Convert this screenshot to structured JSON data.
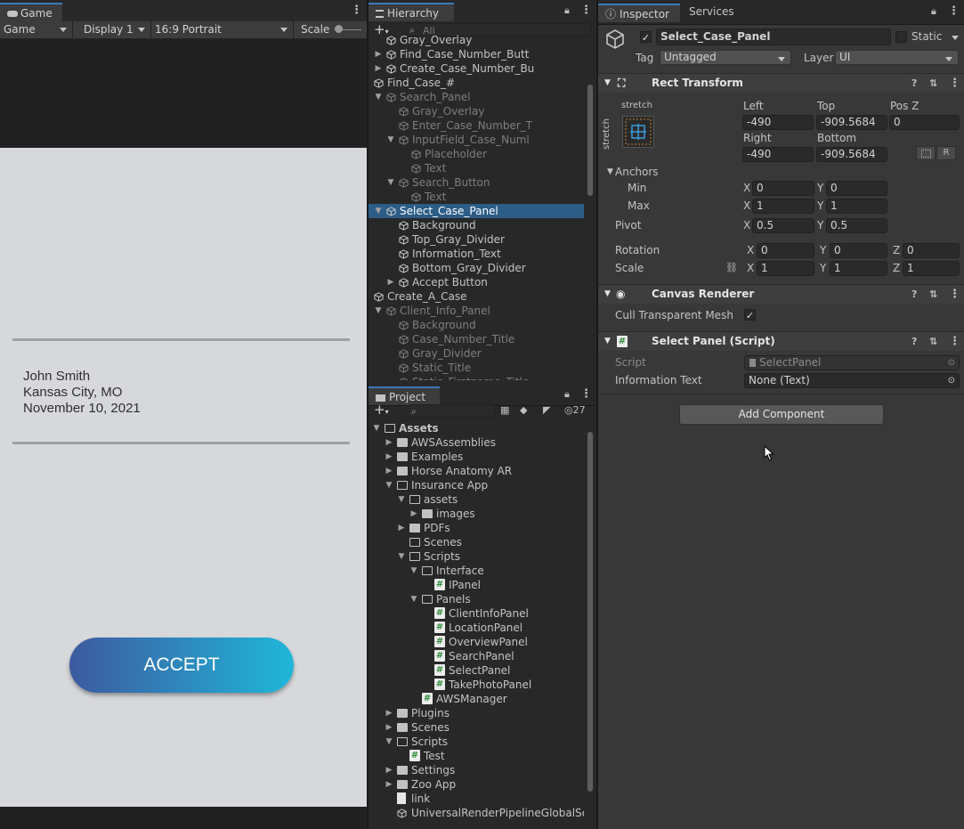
{
  "game": {
    "tab_label": "Game",
    "mode": "Game",
    "display": "Display 1",
    "aspect": "16:9 Portrait",
    "scale_label": "Scale",
    "info_lines": [
      "John Smith",
      "Kansas City, MO",
      "November 10, 2021"
    ],
    "accept_label": "ACCEPT"
  },
  "hierarchy": {
    "tab_label": "Hierarchy",
    "search_placeholder": "All",
    "rows": [
      {
        "label": "Gray_Overlay",
        "depth": 4,
        "arrow": "",
        "dim": false,
        "sel": false
      },
      {
        "label": "Find_Case_Number_Butt",
        "depth": 4,
        "arrow": "right",
        "dim": false,
        "sel": false
      },
      {
        "label": "Create_Case_Number_Bu",
        "depth": 4,
        "arrow": "right",
        "dim": false,
        "sel": false
      },
      {
        "label": "Find_Case_#",
        "depth": 3,
        "arrow": "down",
        "dim": false,
        "sel": false
      },
      {
        "label": "Search_Panel",
        "depth": 4,
        "arrow": "down",
        "dim": true,
        "sel": false
      },
      {
        "label": "Gray_Overlay",
        "depth": 5,
        "arrow": "",
        "dim": true,
        "sel": false
      },
      {
        "label": "Enter_Case_Number_T",
        "depth": 5,
        "arrow": "",
        "dim": true,
        "sel": false
      },
      {
        "label": "InputField_Case_Numl",
        "depth": 5,
        "arrow": "down",
        "dim": true,
        "sel": false
      },
      {
        "label": "Placeholder",
        "depth": 6,
        "arrow": "",
        "dim": true,
        "sel": false
      },
      {
        "label": "Text",
        "depth": 6,
        "arrow": "",
        "dim": true,
        "sel": false
      },
      {
        "label": "Search_Button",
        "depth": 5,
        "arrow": "down",
        "dim": true,
        "sel": false
      },
      {
        "label": "Text",
        "depth": 6,
        "arrow": "",
        "dim": true,
        "sel": false
      },
      {
        "label": "Select_Case_Panel",
        "depth": 4,
        "arrow": "down",
        "dim": false,
        "sel": true
      },
      {
        "label": "Background",
        "depth": 5,
        "arrow": "",
        "dim": false,
        "sel": false
      },
      {
        "label": "Top_Gray_Divider",
        "depth": 5,
        "arrow": "",
        "dim": false,
        "sel": false
      },
      {
        "label": "Information_Text",
        "depth": 5,
        "arrow": "",
        "dim": false,
        "sel": false
      },
      {
        "label": "Bottom_Gray_Divider",
        "depth": 5,
        "arrow": "",
        "dim": false,
        "sel": false
      },
      {
        "label": "Accept Button",
        "depth": 5,
        "arrow": "right",
        "dim": false,
        "sel": false
      },
      {
        "label": "Create_A_Case",
        "depth": 3,
        "arrow": "down",
        "dim": false,
        "sel": false
      },
      {
        "label": "Client_Info_Panel",
        "depth": 4,
        "arrow": "down",
        "dim": true,
        "sel": false
      },
      {
        "label": "Background",
        "depth": 5,
        "arrow": "",
        "dim": true,
        "sel": false
      },
      {
        "label": "Case_Number_Title",
        "depth": 5,
        "arrow": "",
        "dim": true,
        "sel": false
      },
      {
        "label": "Gray_Divider",
        "depth": 5,
        "arrow": "",
        "dim": true,
        "sel": false
      },
      {
        "label": "Static_Title",
        "depth": 5,
        "arrow": "",
        "dim": true,
        "sel": false
      },
      {
        "label": "Static_Firstname_Title",
        "depth": 5,
        "arrow": "",
        "dim": true,
        "sel": false
      }
    ]
  },
  "project": {
    "tab_label": "Project",
    "hidden_count": "27",
    "rows": [
      {
        "label": "Assets",
        "depth": 0,
        "arrow": "down",
        "icon": "folder-open",
        "bold": true
      },
      {
        "label": "AWSAssemblies",
        "depth": 1,
        "arrow": "right",
        "icon": "folder"
      },
      {
        "label": "Examples",
        "depth": 1,
        "arrow": "right",
        "icon": "folder"
      },
      {
        "label": "Horse Anatomy AR",
        "depth": 1,
        "arrow": "right",
        "icon": "folder"
      },
      {
        "label": "Insurance App",
        "depth": 1,
        "arrow": "down",
        "icon": "folder-open"
      },
      {
        "label": "assets",
        "depth": 2,
        "arrow": "down",
        "icon": "folder-open"
      },
      {
        "label": "images",
        "depth": 3,
        "arrow": "right",
        "icon": "folder"
      },
      {
        "label": "PDFs",
        "depth": 2,
        "arrow": "right",
        "icon": "folder"
      },
      {
        "label": "Scenes",
        "depth": 2,
        "arrow": "",
        "icon": "folder-empty"
      },
      {
        "label": "Scripts",
        "depth": 2,
        "arrow": "down",
        "icon": "folder-open"
      },
      {
        "label": "Interface",
        "depth": 3,
        "arrow": "down",
        "icon": "folder-open"
      },
      {
        "label": "IPanel",
        "depth": 4,
        "arrow": "",
        "icon": "script"
      },
      {
        "label": "Panels",
        "depth": 3,
        "arrow": "down",
        "icon": "folder-open"
      },
      {
        "label": "ClientInfoPanel",
        "depth": 4,
        "arrow": "",
        "icon": "script"
      },
      {
        "label": "LocationPanel",
        "depth": 4,
        "arrow": "",
        "icon": "script"
      },
      {
        "label": "OverviewPanel",
        "depth": 4,
        "arrow": "",
        "icon": "script"
      },
      {
        "label": "SearchPanel",
        "depth": 4,
        "arrow": "",
        "icon": "script"
      },
      {
        "label": "SelectPanel",
        "depth": 4,
        "arrow": "",
        "icon": "script"
      },
      {
        "label": "TakePhotoPanel",
        "depth": 4,
        "arrow": "",
        "icon": "script"
      },
      {
        "label": "AWSManager",
        "depth": 3,
        "arrow": "",
        "icon": "script"
      },
      {
        "label": "Plugins",
        "depth": 1,
        "arrow": "right",
        "icon": "folder"
      },
      {
        "label": "Scenes",
        "depth": 1,
        "arrow": "right",
        "icon": "folder"
      },
      {
        "label": "Scripts",
        "depth": 1,
        "arrow": "down",
        "icon": "folder-open"
      },
      {
        "label": "Test",
        "depth": 2,
        "arrow": "",
        "icon": "script"
      },
      {
        "label": "Settings",
        "depth": 1,
        "arrow": "right",
        "icon": "folder"
      },
      {
        "label": "Zoo App",
        "depth": 1,
        "arrow": "right",
        "icon": "folder"
      },
      {
        "label": "link",
        "depth": 1,
        "arrow": "",
        "icon": "doc"
      },
      {
        "label": "UniversalRenderPipelineGlobalSet",
        "depth": 1,
        "arrow": "",
        "icon": "asset"
      }
    ]
  },
  "inspector": {
    "tab_label": "Inspector",
    "services_label": "Services",
    "object_name": "Select_Case_Panel",
    "static_label": "Static",
    "tag_label": "Tag",
    "tag_value": "Untagged",
    "layer_label": "Layer",
    "layer_value": "UI",
    "rect": {
      "title": "Rect Transform",
      "stretch_h": "stretch",
      "stretch_v": "stretch",
      "left_label": "Left",
      "left": "-490",
      "top_label": "Top",
      "top": "-909.5684",
      "posz_label": "Pos Z",
      "posz": "0",
      "right_label": "Right",
      "right": "-490",
      "bottom_label": "Bottom",
      "bottom": "-909.5684",
      "r_label": "R",
      "anchors_label": "Anchors",
      "min_label": "Min",
      "min_x": "0",
      "min_y": "0",
      "max_label": "Max",
      "max_x": "1",
      "max_y": "1",
      "pivot_label": "Pivot",
      "pivot_x": "0.5",
      "pivot_y": "0.5",
      "rotation_label": "Rotation",
      "rot_x": "0",
      "rot_y": "0",
      "rot_z": "0",
      "scale_label": "Scale",
      "scale_x": "1",
      "scale_y": "1",
      "scale_z": "1",
      "x": "X",
      "y": "Y",
      "z": "Z"
    },
    "canvas": {
      "title": "Canvas Renderer",
      "cull_label": "Cull Transparent Mesh"
    },
    "script_comp": {
      "title": "Select Panel (Script)",
      "script_label": "Script",
      "script_value": "SelectPanel",
      "info_label": "Information Text",
      "info_value": "None (Text)"
    },
    "add_component": "Add Component"
  }
}
